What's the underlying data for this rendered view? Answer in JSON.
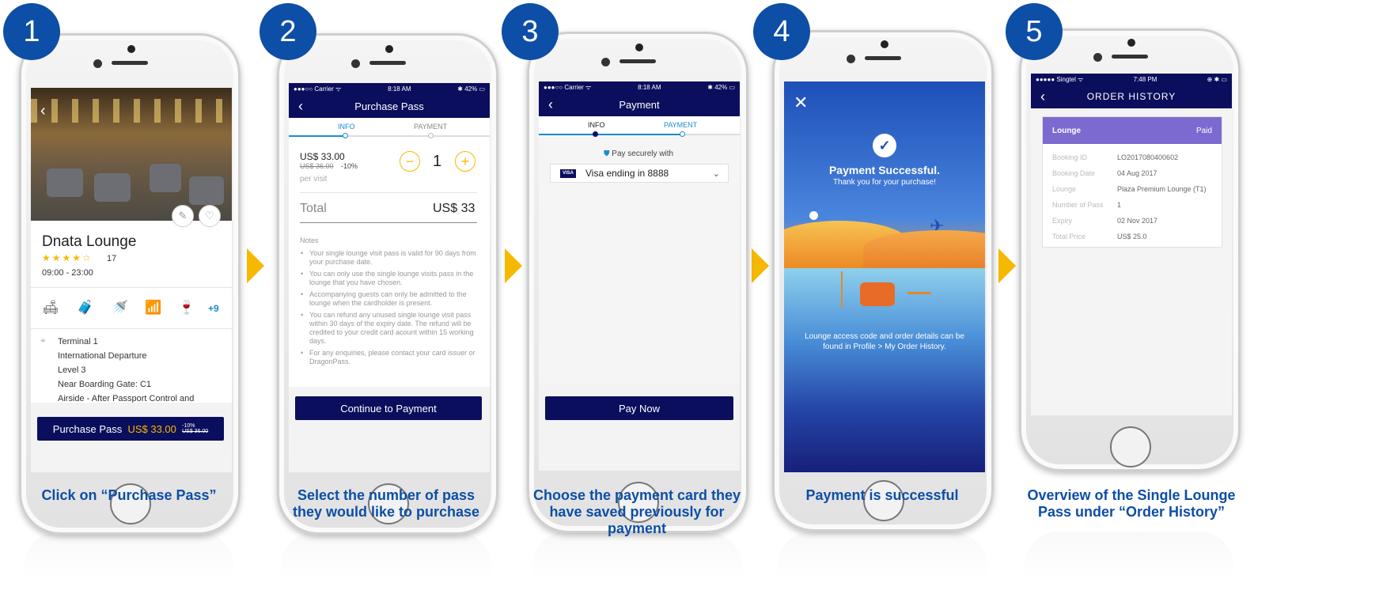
{
  "steps": [
    {
      "num": "1",
      "caption": "Click on “Purchase Pass”"
    },
    {
      "num": "2",
      "caption": "Select the number of pass they would like to purchase"
    },
    {
      "num": "3",
      "caption": "Choose the payment card they have saved previously for payment"
    },
    {
      "num": "4",
      "caption": "Payment is successful"
    },
    {
      "num": "5",
      "caption": "Overview of the Single Lounge Pass under “Order History”"
    }
  ],
  "screen1": {
    "lounge_name": "Dnata Lounge",
    "rating_count": "17",
    "hours": "09:00 - 23:00",
    "amenities_more": "+9",
    "address": [
      "Terminal 1",
      "International Departure",
      "Level 3",
      "Near Boarding Gate: C1",
      "Airside - After Passport Control and"
    ],
    "purchase_label": "Purchase Pass",
    "purchase_price": "US$ 33.00",
    "discount": "-10%",
    "old_price": "US$ 36.00"
  },
  "screen2": {
    "status_left": "●●●○○ Carrier ᯤ",
    "status_time": "8:18 AM",
    "status_right": "✱ 42% ▭",
    "title": "Purchase Pass",
    "tab_info": "INFO",
    "tab_payment": "PAYMENT",
    "price": "US$ 33.00",
    "old_price": "US$ 36.00",
    "discount": "-10%",
    "per_visit": "per visit",
    "minus": "−",
    "quantity": "1",
    "plus": "+",
    "total_label": "Total",
    "total_value": "US$ 33",
    "notes_heading": "Notes",
    "notes": [
      "Your single lounge visit pass is valid for 90 days from your purchase date.",
      "You can only use the single lounge visits pass in the lounge that you have chosen.",
      "Accompanying guests can only be admitted to the lounge when the cardholder is present.",
      "You can refund any unused single lounge visit pass within 30 days of the expiry date. The refund will be credited to your credit card acount within 15 working days.",
      "For any enquiries, please contact your card issuer or DragonPass."
    ],
    "button": "Continue to Payment"
  },
  "screen3": {
    "status_left": "●●●○○ Carrier ᯤ",
    "status_time": "8:18 AM",
    "status_right": "✱ 42% ▭",
    "title": "Payment",
    "tab_info": "INFO",
    "tab_payment": "PAYMENT",
    "secure_text": "Pay securely with",
    "card_brand": "VISA",
    "card_text": "Visa ending in 8888",
    "button": "Pay Now"
  },
  "screen4": {
    "title": "Payment Successful.",
    "subtitle": "Thank you for your purchase!",
    "info": "Lounge access code and order details can be found in Profile > My Order History."
  },
  "screen5": {
    "status_left": "●●●●● Singtel ᯤ",
    "status_time": "7:48 PM",
    "status_right": "⊕ ✱ ▭",
    "title": "ORDER HISTORY",
    "panel_title": "Lounge",
    "panel_status": "Paid",
    "rows": [
      {
        "k": "Booking ID",
        "v": "LO2017080400602"
      },
      {
        "k": "Booking Date",
        "v": "04 Aug 2017"
      },
      {
        "k": "Lounge",
        "v": "Plaza Premium Lounge (T1)"
      },
      {
        "k": "Number of Pass",
        "v": "1"
      },
      {
        "k": "Expiry",
        "v": "02 Nov 2017"
      },
      {
        "k": "Total Price",
        "v": "US$ 25.0"
      }
    ]
  },
  "colors": {
    "navy": "#0b0e5c",
    "step_blue": "#0d4ea6",
    "arrow_gold": "#f6b800",
    "accent_blue": "#1a8ccf",
    "panel_purple": "#7c6ad0"
  }
}
